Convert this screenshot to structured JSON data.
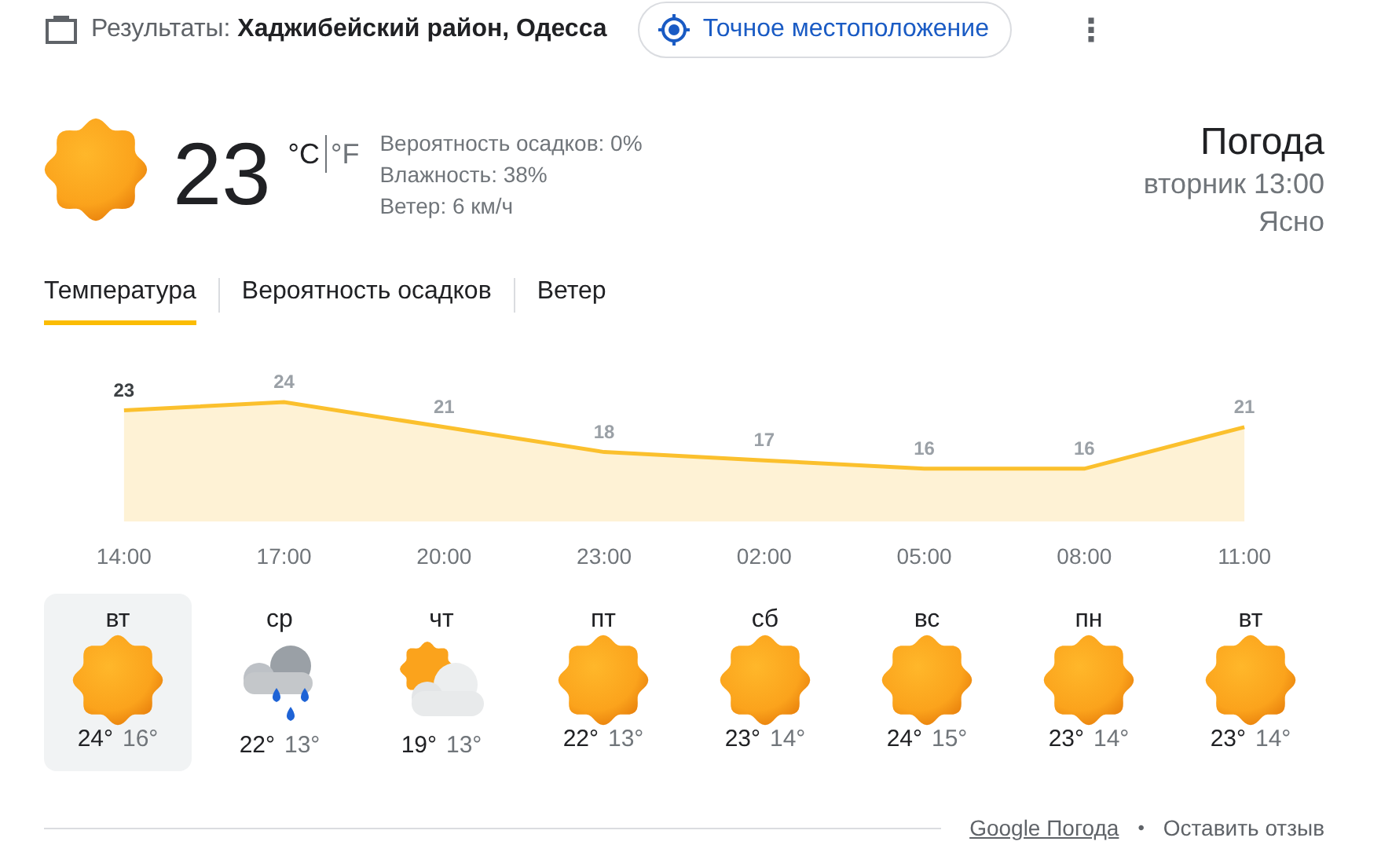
{
  "header": {
    "results": "Результаты: **Хаджибейский район, Одесса**",
    "location_button": "Точное местоположение",
    "more": "⋮"
  },
  "current": {
    "temp": "23",
    "units": [
      {
        "label": "°C",
        "selected": true
      },
      {
        "label": "°F",
        "selected": false
      }
    ],
    "details": [
      "Вероятность осадков: 0%",
      "Влажность: 38%",
      "Ветер: 6 км/ч"
    ],
    "title": "Погода",
    "time": "вторник 13:00",
    "condition": "Ясно"
  },
  "tabs": [
    {
      "label": "Температура",
      "selected": true
    },
    {
      "label": "Вероятность осадков",
      "selected": false
    },
    {
      "label": "Ветер",
      "selected": false
    }
  ],
  "chart_data": {
    "type": "area",
    "categories": [
      "14:00",
      "17:00",
      "20:00",
      "23:00",
      "02:00",
      "05:00",
      "08:00",
      "11:00"
    ],
    "series": [
      {
        "color": "#fbc02d",
        "values": [
          23,
          24,
          21,
          18,
          17,
          16,
          16,
          21
        ]
      }
    ],
    "data_labels": true
  },
  "days": [
    {
      "day": "вт",
      "kind": "sun",
      "high": "24°",
      "low": "16°",
      "selected": true
    },
    {
      "day": "ср",
      "kind": "rain",
      "high": "22°",
      "low": "13°",
      "selected": false
    },
    {
      "day": "чт",
      "kind": "partly_cloudy",
      "high": "19°",
      "low": "13°",
      "selected": false
    },
    {
      "day": "пт",
      "kind": "sun",
      "high": "22°",
      "low": "13°",
      "selected": false
    },
    {
      "day": "сб",
      "kind": "sun",
      "high": "23°",
      "low": "14°",
      "selected": false
    },
    {
      "day": "вс",
      "kind": "sun",
      "high": "24°",
      "low": "15°",
      "selected": false
    },
    {
      "day": "пн",
      "kind": "sun",
      "high": "23°",
      "low": "14°",
      "selected": false
    },
    {
      "day": "вт",
      "kind": "sun",
      "high": "23°",
      "low": "14°",
      "selected": false
    }
  ],
  "footer": {
    "link": "Google Погода",
    "separator": "•",
    "feedback": "Оставить отзыв"
  }
}
